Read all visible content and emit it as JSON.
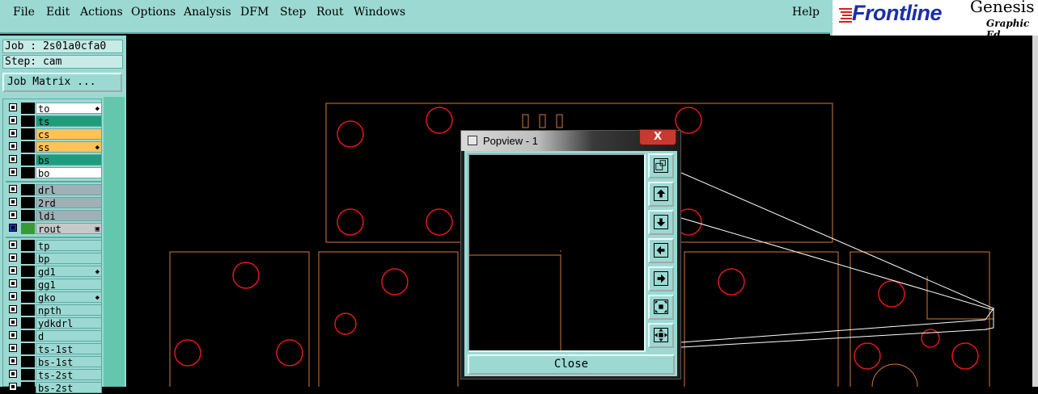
{
  "menu": {
    "items": [
      {
        "label": "File"
      },
      {
        "label": "Edit"
      },
      {
        "label": "Actions"
      },
      {
        "label": "Options"
      },
      {
        "label": "Analysis"
      },
      {
        "label": "DFM"
      },
      {
        "label": "Step"
      },
      {
        "label": "Rout"
      },
      {
        "label": "Windows"
      }
    ],
    "help": "Help"
  },
  "brand": {
    "logo": "Frontline",
    "product": "Genesis",
    "subtitle": "Graphic Ed"
  },
  "panel": {
    "job": "Job : 2s01a0cfa0",
    "step": "Step: cam",
    "job_matrix": "Job Matrix ..."
  },
  "layers": [
    {
      "name": "to",
      "color": "#ffffff",
      "swatch": "#000000",
      "mark": "◆"
    },
    {
      "name": "ts",
      "color": "#1f9b7d",
      "swatch": "#000000",
      "mark": ""
    },
    {
      "name": "cs",
      "color": "#ffc35a",
      "swatch": "#000000",
      "mark": ""
    },
    {
      "name": "ss",
      "color": "#ffc35a",
      "swatch": "#000000",
      "mark": "◆"
    },
    {
      "name": "bs",
      "color": "#1f9b7d",
      "swatch": "#000000",
      "mark": ""
    },
    {
      "name": "bo",
      "color": "#ffffff",
      "swatch": "#000000",
      "mark": ""
    },
    {
      "name": "drl",
      "color": "#9fb1b7",
      "swatch": "#000000",
      "mark": ""
    },
    {
      "name": "2rd",
      "color": "#9fb1b7",
      "swatch": "#000000",
      "mark": ""
    },
    {
      "name": "ldi",
      "color": "#9fb1b7",
      "swatch": "#000000",
      "mark": ""
    },
    {
      "name": "rout",
      "color": "#c8c8c8",
      "swatch": "#3a9a32",
      "mark": "▣"
    },
    {
      "name": "tp",
      "color": "#9cd9d3",
      "swatch": "#000000",
      "mark": ""
    },
    {
      "name": "bp",
      "color": "#9cd9d3",
      "swatch": "#000000",
      "mark": ""
    },
    {
      "name": "gd1",
      "color": "#9cd9d3",
      "swatch": "#000000",
      "mark": "◆"
    },
    {
      "name": "gg1",
      "color": "#9cd9d3",
      "swatch": "#000000",
      "mark": ""
    },
    {
      "name": "gko",
      "color": "#9cd9d3",
      "swatch": "#000000",
      "mark": "◆"
    },
    {
      "name": "npth",
      "color": "#9cd9d3",
      "swatch": "#000000",
      "mark": ""
    },
    {
      "name": "ydkdrl",
      "color": "#9cd9d3",
      "swatch": "#000000",
      "mark": ""
    },
    {
      "name": "d",
      "color": "#9cd9d3",
      "swatch": "#000000",
      "mark": ""
    },
    {
      "name": "ts-1st",
      "color": "#9cd9d3",
      "swatch": "#000000",
      "mark": ""
    },
    {
      "name": "bs-1st",
      "color": "#9cd9d3",
      "swatch": "#000000",
      "mark": ""
    },
    {
      "name": "ts-2st",
      "color": "#9cd9d3",
      "swatch": "#000000",
      "mark": ""
    },
    {
      "name": "bs-2st",
      "color": "#9cd9d3",
      "swatch": "#000000",
      "mark": ""
    }
  ],
  "popview": {
    "title": "Popview - 1",
    "close_x": "X",
    "close_button": "Close",
    "tools": [
      {
        "icon": "zoom-window-icon"
      },
      {
        "icon": "pan-up-icon"
      },
      {
        "icon": "pan-down-icon"
      },
      {
        "icon": "pan-left-icon"
      },
      {
        "icon": "pan-right-icon"
      },
      {
        "icon": "zoom-in-icon"
      },
      {
        "icon": "zoom-out-icon"
      }
    ]
  },
  "colors": {
    "ui": "#9cd9d3",
    "outline": "#d07a3a",
    "pads": "#e01818"
  }
}
